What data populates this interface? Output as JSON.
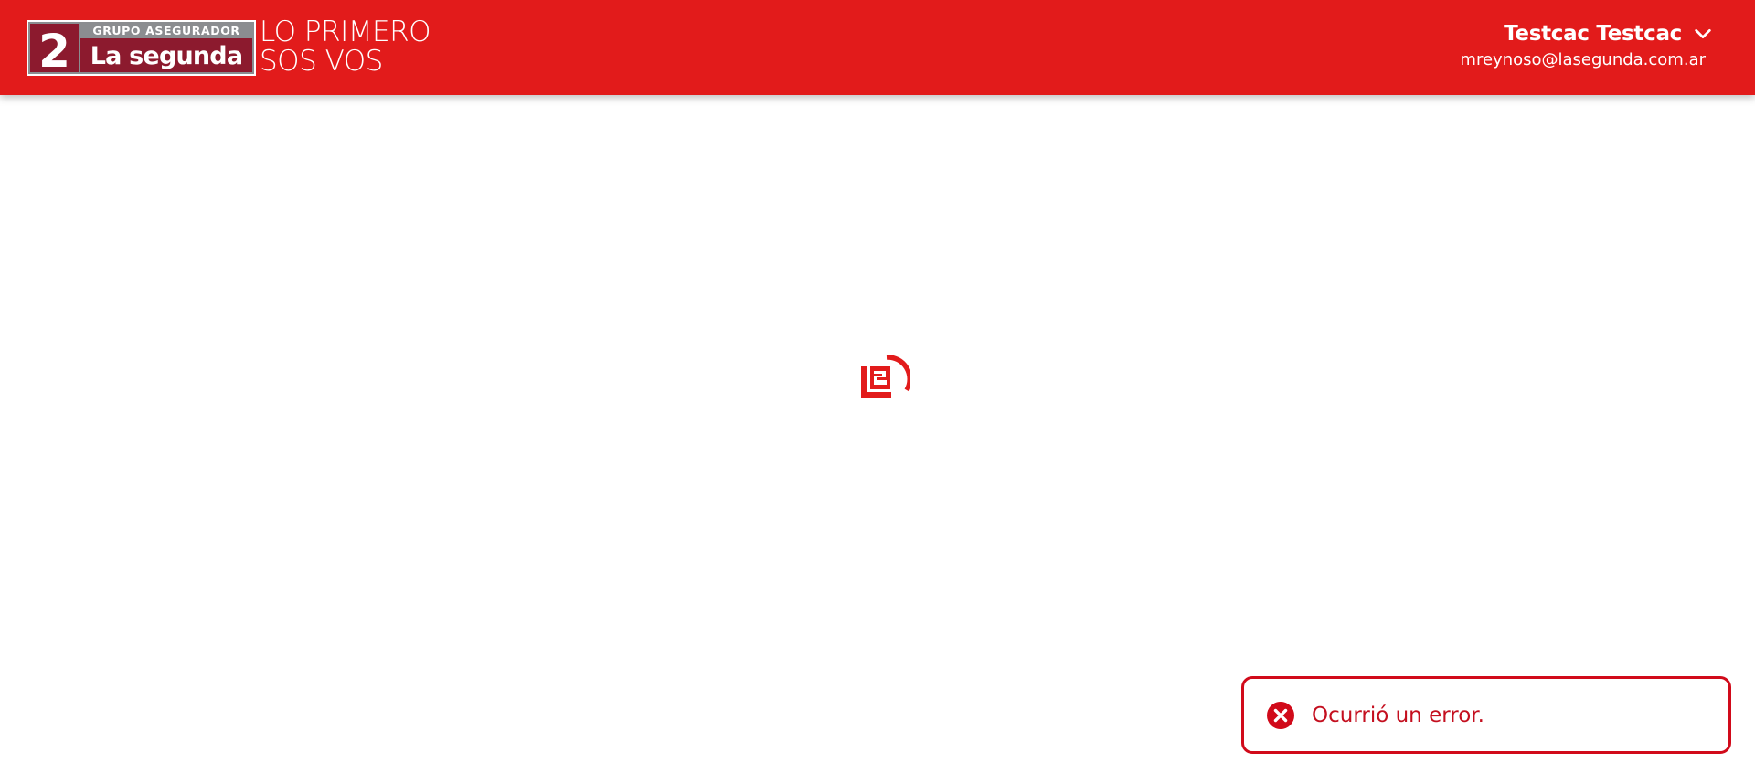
{
  "header": {
    "logo": {
      "group_text": "GRUPO ASEGURADOR",
      "brand_text": "La segunda",
      "emblem_text": "2"
    },
    "tagline": {
      "line1": "LO PRIMERO",
      "line2": "SOS VOS"
    },
    "user": {
      "name": "Testcac Testcac",
      "email": "mreynoso@lasegunda.com.ar",
      "menu_icon": "chevron-down-icon"
    }
  },
  "main": {
    "loading_icon": "la-segunda-spinner-icon"
  },
  "toast": {
    "message": "Ocurrió un error.",
    "icon": "error-circle-icon"
  },
  "colors": {
    "brand_red": "#e21b1b",
    "error_red": "#d10a1a",
    "logo_gray": "#8b8d90",
    "logo_maroon": "#8c1a2e"
  }
}
